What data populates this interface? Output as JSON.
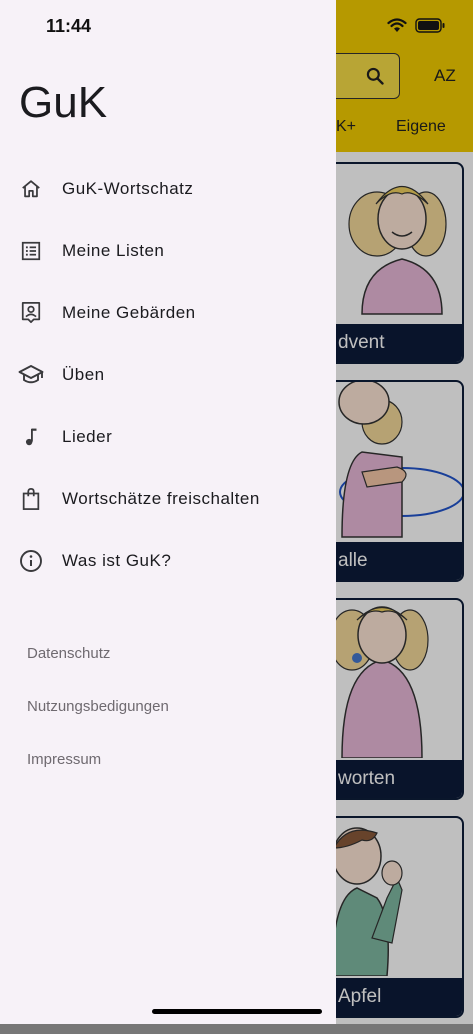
{
  "status_bar": {
    "time": "11:44"
  },
  "drawer": {
    "title": "GuK",
    "menu": [
      {
        "label": "GuK-Wortschatz",
        "icon": "home-icon"
      },
      {
        "label": "Meine Listen",
        "icon": "list-icon"
      },
      {
        "label": "Meine Gebärden",
        "icon": "portrait-icon"
      },
      {
        "label": "Üben",
        "icon": "school-icon"
      },
      {
        "label": "Lieder",
        "icon": "music-note-icon"
      },
      {
        "label": "Wortschätze freischalten",
        "icon": "shopping-bag-icon"
      },
      {
        "label": "Was ist GuK?",
        "icon": "info-icon"
      }
    ],
    "footer_links": [
      "Datenschutz",
      "Nutzungsbedigungen",
      "Impressum"
    ]
  },
  "background": {
    "sort_label": "AZ",
    "tabs": [
      "K+",
      "Eigene"
    ],
    "cards": [
      "dvent",
      "alle",
      "worten",
      "Apfel"
    ]
  },
  "colors": {
    "header": "#f3cd00",
    "drawer_bg": "#f7f2f8",
    "card_label_bg": "#0d1b3a"
  }
}
